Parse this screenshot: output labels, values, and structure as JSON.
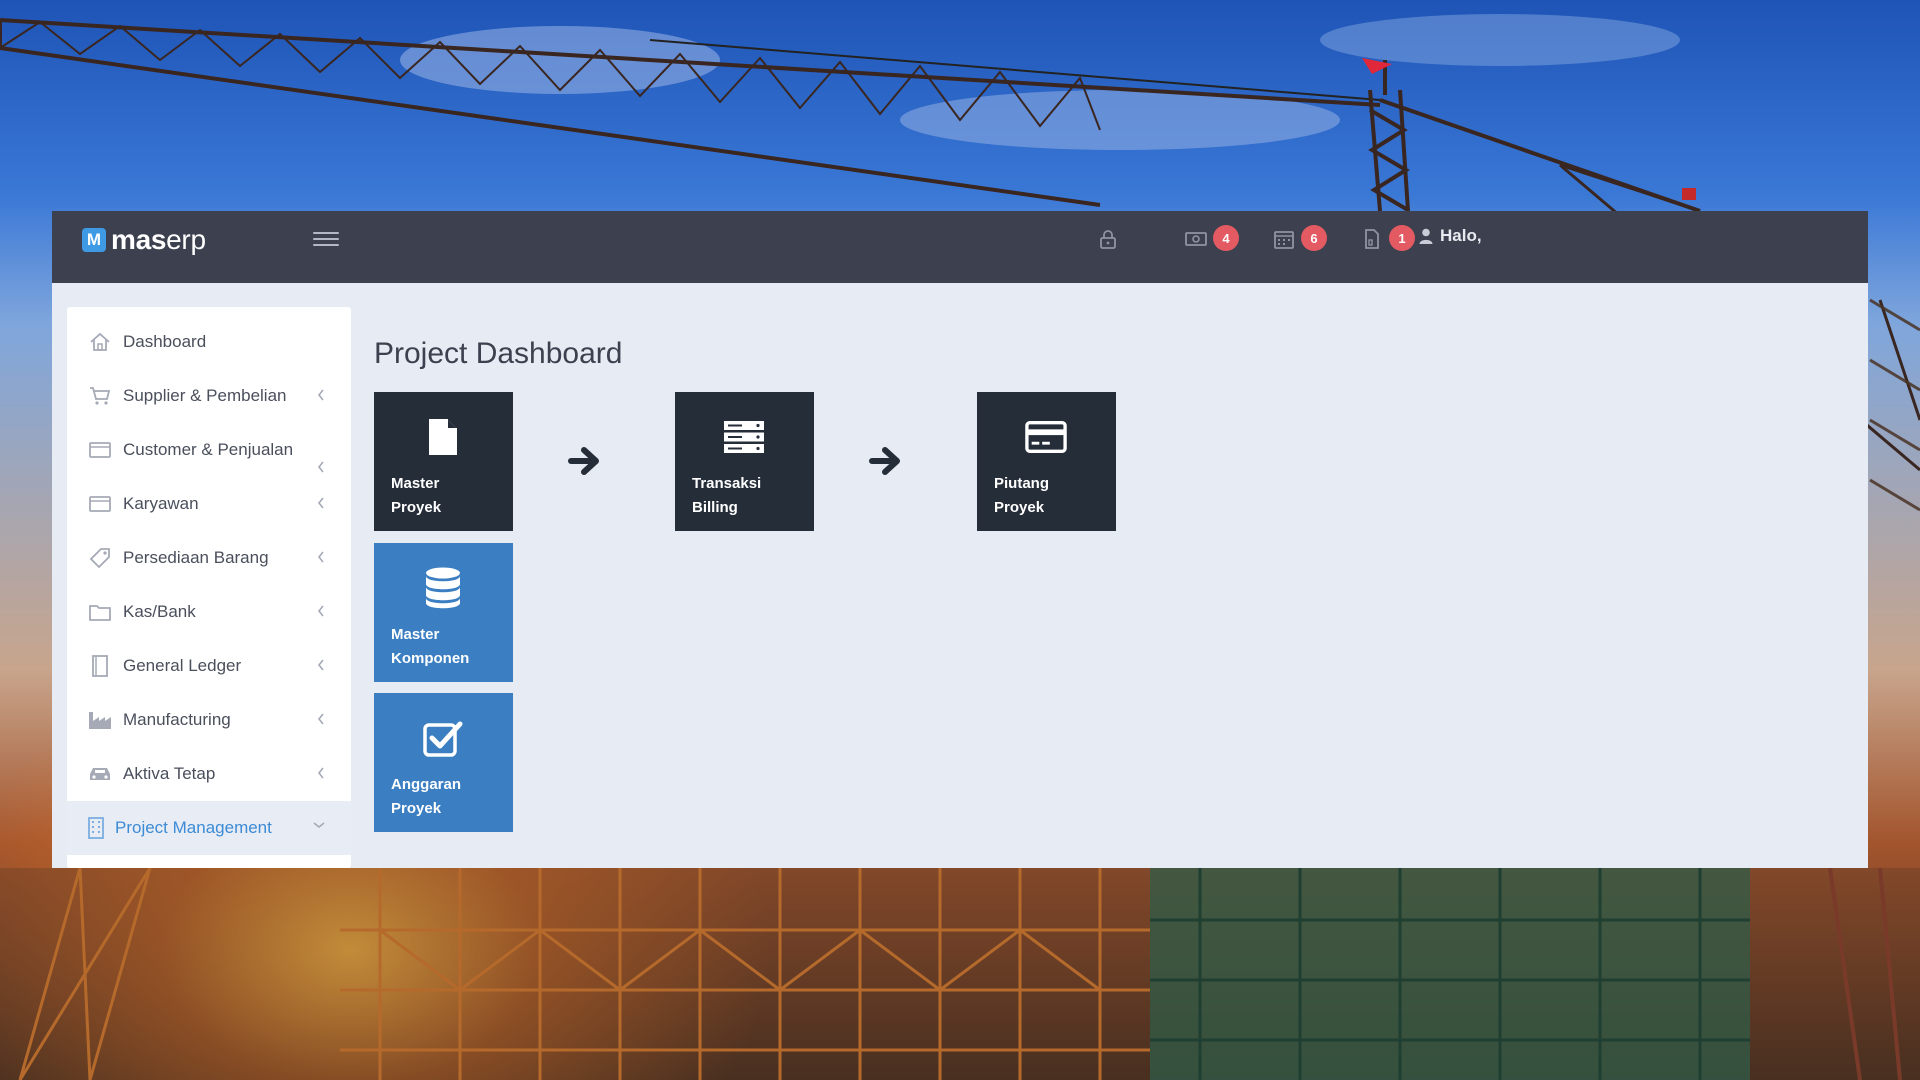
{
  "app": {
    "logo_mark": "M",
    "logo_bold": "mas",
    "logo_light": "erp"
  },
  "topbar": {
    "icons": [
      {
        "icon": "lock-icon",
        "badge": ""
      },
      {
        "icon": "money-icon",
        "badge": "4"
      },
      {
        "icon": "calendar-icon",
        "badge": "6"
      },
      {
        "icon": "document-icon",
        "badge": "1"
      }
    ],
    "greeting": "Halo,"
  },
  "sidebar": {
    "items": [
      {
        "label": "Dashboard",
        "icon": "home-icon",
        "chevron": ""
      },
      {
        "label": "Supplier & Pembelian",
        "icon": "cart-icon",
        "chevron": "left"
      },
      {
        "label": "Customer & Penjualan",
        "icon": "card-icon",
        "chevron": "left"
      },
      {
        "label": "Karyawan",
        "icon": "card-icon",
        "chevron": "left"
      },
      {
        "label": "Persediaan Barang",
        "icon": "tag-icon",
        "chevron": "left"
      },
      {
        "label": "Kas/Bank",
        "icon": "folder-icon",
        "chevron": "left"
      },
      {
        "label": "General Ledger",
        "icon": "book-icon",
        "chevron": "left"
      },
      {
        "label": "Manufacturing",
        "icon": "factory-icon",
        "chevron": "left"
      },
      {
        "label": "Aktiva Tetap",
        "icon": "car-icon",
        "chevron": "left"
      },
      {
        "label": "Project Management",
        "icon": "building-icon",
        "chevron": "down",
        "active": true
      }
    ]
  },
  "main": {
    "title": "Project Dashboard",
    "tiles": [
      {
        "label": "Master\nProyek",
        "icon": "file-icon",
        "style": "dark"
      },
      {
        "label": "Transaksi\nBilling",
        "icon": "server-icon",
        "style": "dark"
      },
      {
        "label": "Piutang\nProyek",
        "icon": "credit-card-icon",
        "style": "dark"
      },
      {
        "label": "Master\nKomponen",
        "icon": "database-icon",
        "style": "blue"
      },
      {
        "label": "Anggaran\nProyek",
        "icon": "check-square-icon",
        "style": "blue"
      }
    ]
  },
  "colors": {
    "topbar": "#3d414f",
    "tile_dark": "#252d39",
    "tile_blue": "#3b7fc2",
    "badge": "#e45a62",
    "active_nav": "#3c8bd6"
  }
}
